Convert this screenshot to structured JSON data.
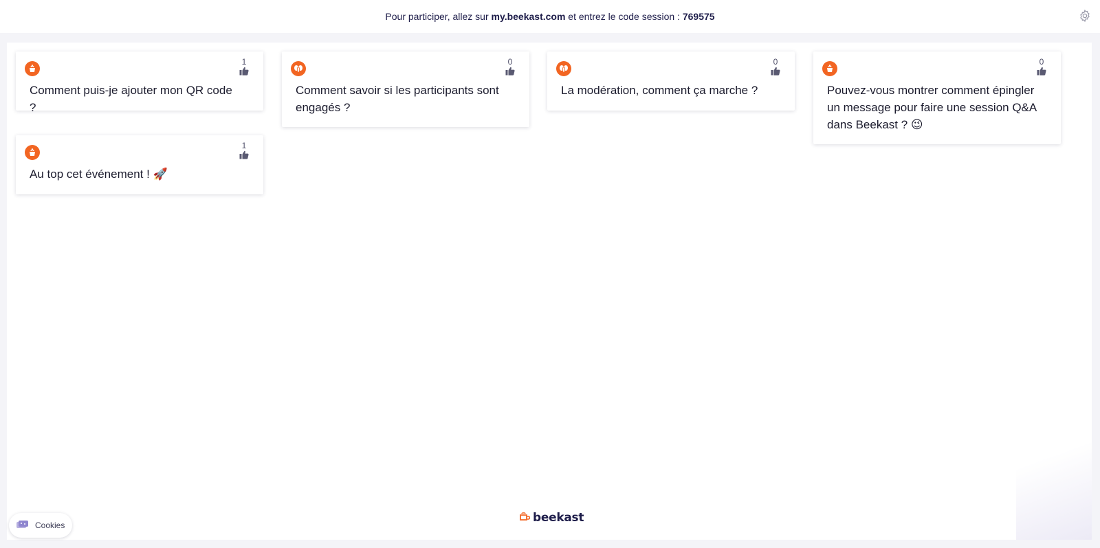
{
  "header": {
    "prefix": "Pour participer, allez sur ",
    "site": "my.beekast.com",
    "middle": " et entrez le code session : ",
    "code": "769575",
    "settings_icon": "gear-icon"
  },
  "messages": [
    {
      "text": "Comment puis-je ajouter mon QR code ?",
      "likes": "1",
      "avatar_icon": "bee-hat-icon"
    },
    {
      "text": "Comment savoir si les participants sont engagés ?",
      "likes": "0",
      "avatar_icon": "bee-wings-icon"
    },
    {
      "text": "La modération, comment ça marche ?",
      "likes": "0",
      "avatar_icon": "bee-wings-icon"
    },
    {
      "text": "Pouvez-vous montrer comment épingler un message pour faire une session Q&A dans Beekast ? 😉",
      "likes": "0",
      "avatar_icon": "bee-hat-icon"
    },
    {
      "text": "Au top cet événement ! 🚀",
      "likes": "1",
      "avatar_icon": "bee-hat-icon"
    }
  ],
  "cookies": {
    "label": "Cookies",
    "icon": "cookie-icon"
  },
  "footer": {
    "brand": "beekast",
    "icon": "beekast-logo-icon"
  },
  "colors": {
    "accent": "#f26522",
    "brand_text": "#1e1d4a",
    "like_icon": "#5a5a72"
  }
}
